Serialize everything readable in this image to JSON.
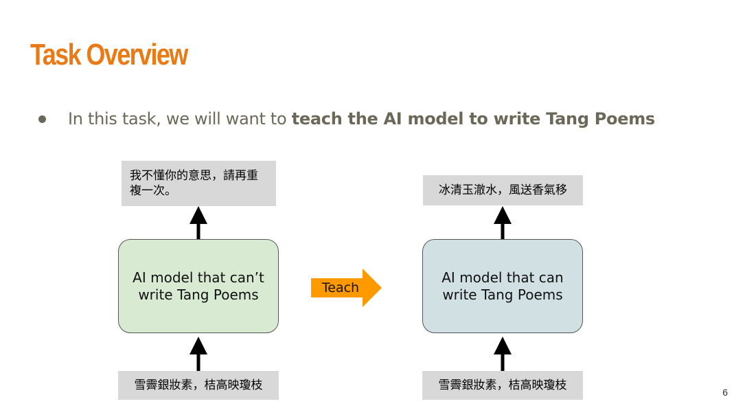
{
  "slide": {
    "title": "Task Overview",
    "bullet": {
      "prefix": "In this task, we will want to ",
      "bold": "teach the AI model to write Tang Poems"
    },
    "page_number": "6"
  },
  "diagram": {
    "left": {
      "output_text": "我不懂你的意思，請再重複一次。",
      "model_line1": "AI model that can’t",
      "model_line2": "write Tang Poems",
      "input_text": "雪霽銀妝素，桔高映瓊枝"
    },
    "right": {
      "output_text": "冰清玉澈水，風送香氣移",
      "model_line1": "AI model that can",
      "model_line2": "write Tang Poems",
      "input_text": "雪霽銀妝素，桔高映瓊枝"
    },
    "teach_label": "Teach"
  },
  "colors": {
    "title": "#ea7a13",
    "body_text": "#6c6858",
    "gray_box": "#d8d8d8",
    "left_model_fill": "#d9ead3",
    "right_model_fill": "#d0e0e3",
    "teach_arrow": "#ff9900",
    "arrow": "#000000"
  },
  "icons": {
    "bullet": "bullet-dot",
    "arrow_up": "arrow-up-icon",
    "teach_arrow": "arrow-right-icon"
  }
}
